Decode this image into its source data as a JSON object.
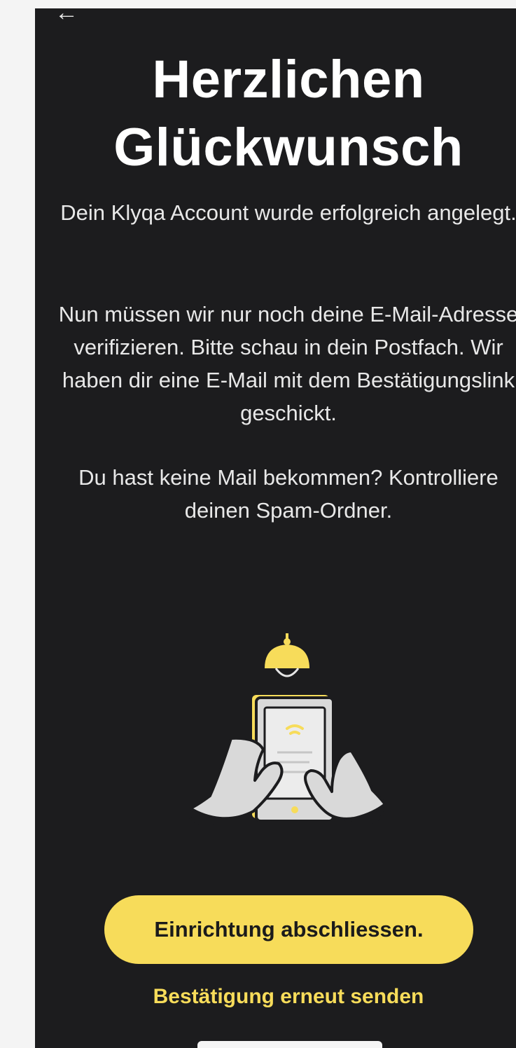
{
  "nav": {
    "back_icon": "arrow-left-icon",
    "back_glyph": "←"
  },
  "header": {
    "title_line1": "Herzlichen",
    "title_line2": "Glückwunsch"
  },
  "body": {
    "para1": "Dein Klyqa Account wurde erfolgreich angelegt.",
    "para2": "Nun müssen wir nur noch deine E-Mail-Adresse verifizieren. Bitte schau in dein Postfach. Wir haben dir eine E-Mail mit dem Bestätigungslink geschickt.",
    "para3": "Du hast keine Mail bekommen? Kontrolliere deinen Spam-Ordner."
  },
  "illustration": {
    "icon": "phone-with-hands-under-lamp-icon"
  },
  "actions": {
    "primary_label": "Einrichtung abschliessen.",
    "resend_label": "Bestätigung erneut senden"
  },
  "colors": {
    "background": "#1c1c1e",
    "accent": "#f7dc5a",
    "text": "#ffffff"
  }
}
